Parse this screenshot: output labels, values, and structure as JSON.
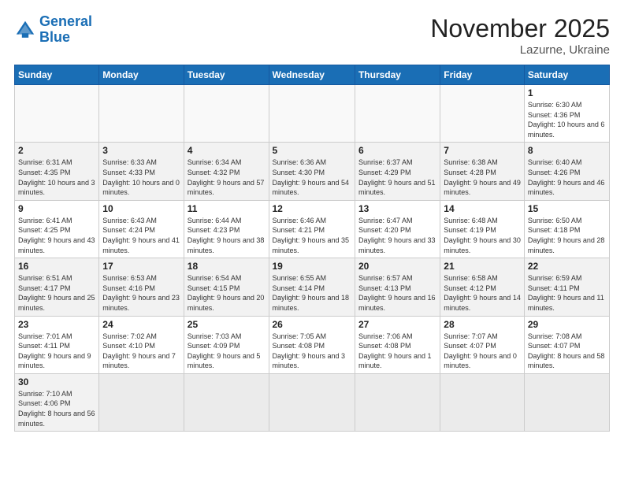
{
  "header": {
    "logo_general": "General",
    "logo_blue": "Blue",
    "title": "November 2025",
    "subtitle": "Lazurne, Ukraine"
  },
  "weekdays": [
    "Sunday",
    "Monday",
    "Tuesday",
    "Wednesday",
    "Thursday",
    "Friday",
    "Saturday"
  ],
  "weeks": [
    {
      "days": [
        {
          "num": "",
          "info": ""
        },
        {
          "num": "",
          "info": ""
        },
        {
          "num": "",
          "info": ""
        },
        {
          "num": "",
          "info": ""
        },
        {
          "num": "",
          "info": ""
        },
        {
          "num": "",
          "info": ""
        },
        {
          "num": "1",
          "info": "Sunrise: 6:30 AM\nSunset: 4:36 PM\nDaylight: 10 hours and 6 minutes."
        }
      ]
    },
    {
      "days": [
        {
          "num": "2",
          "info": "Sunrise: 6:31 AM\nSunset: 4:35 PM\nDaylight: 10 hours and 3 minutes."
        },
        {
          "num": "3",
          "info": "Sunrise: 6:33 AM\nSunset: 4:33 PM\nDaylight: 10 hours and 0 minutes."
        },
        {
          "num": "4",
          "info": "Sunrise: 6:34 AM\nSunset: 4:32 PM\nDaylight: 9 hours and 57 minutes."
        },
        {
          "num": "5",
          "info": "Sunrise: 6:36 AM\nSunset: 4:30 PM\nDaylight: 9 hours and 54 minutes."
        },
        {
          "num": "6",
          "info": "Sunrise: 6:37 AM\nSunset: 4:29 PM\nDaylight: 9 hours and 51 minutes."
        },
        {
          "num": "7",
          "info": "Sunrise: 6:38 AM\nSunset: 4:28 PM\nDaylight: 9 hours and 49 minutes."
        },
        {
          "num": "8",
          "info": "Sunrise: 6:40 AM\nSunset: 4:26 PM\nDaylight: 9 hours and 46 minutes."
        }
      ]
    },
    {
      "days": [
        {
          "num": "9",
          "info": "Sunrise: 6:41 AM\nSunset: 4:25 PM\nDaylight: 9 hours and 43 minutes."
        },
        {
          "num": "10",
          "info": "Sunrise: 6:43 AM\nSunset: 4:24 PM\nDaylight: 9 hours and 41 minutes."
        },
        {
          "num": "11",
          "info": "Sunrise: 6:44 AM\nSunset: 4:23 PM\nDaylight: 9 hours and 38 minutes."
        },
        {
          "num": "12",
          "info": "Sunrise: 6:46 AM\nSunset: 4:21 PM\nDaylight: 9 hours and 35 minutes."
        },
        {
          "num": "13",
          "info": "Sunrise: 6:47 AM\nSunset: 4:20 PM\nDaylight: 9 hours and 33 minutes."
        },
        {
          "num": "14",
          "info": "Sunrise: 6:48 AM\nSunset: 4:19 PM\nDaylight: 9 hours and 30 minutes."
        },
        {
          "num": "15",
          "info": "Sunrise: 6:50 AM\nSunset: 4:18 PM\nDaylight: 9 hours and 28 minutes."
        }
      ]
    },
    {
      "days": [
        {
          "num": "16",
          "info": "Sunrise: 6:51 AM\nSunset: 4:17 PM\nDaylight: 9 hours and 25 minutes."
        },
        {
          "num": "17",
          "info": "Sunrise: 6:53 AM\nSunset: 4:16 PM\nDaylight: 9 hours and 23 minutes."
        },
        {
          "num": "18",
          "info": "Sunrise: 6:54 AM\nSunset: 4:15 PM\nDaylight: 9 hours and 20 minutes."
        },
        {
          "num": "19",
          "info": "Sunrise: 6:55 AM\nSunset: 4:14 PM\nDaylight: 9 hours and 18 minutes."
        },
        {
          "num": "20",
          "info": "Sunrise: 6:57 AM\nSunset: 4:13 PM\nDaylight: 9 hours and 16 minutes."
        },
        {
          "num": "21",
          "info": "Sunrise: 6:58 AM\nSunset: 4:12 PM\nDaylight: 9 hours and 14 minutes."
        },
        {
          "num": "22",
          "info": "Sunrise: 6:59 AM\nSunset: 4:11 PM\nDaylight: 9 hours and 11 minutes."
        }
      ]
    },
    {
      "days": [
        {
          "num": "23",
          "info": "Sunrise: 7:01 AM\nSunset: 4:11 PM\nDaylight: 9 hours and 9 minutes."
        },
        {
          "num": "24",
          "info": "Sunrise: 7:02 AM\nSunset: 4:10 PM\nDaylight: 9 hours and 7 minutes."
        },
        {
          "num": "25",
          "info": "Sunrise: 7:03 AM\nSunset: 4:09 PM\nDaylight: 9 hours and 5 minutes."
        },
        {
          "num": "26",
          "info": "Sunrise: 7:05 AM\nSunset: 4:08 PM\nDaylight: 9 hours and 3 minutes."
        },
        {
          "num": "27",
          "info": "Sunrise: 7:06 AM\nSunset: 4:08 PM\nDaylight: 9 hours and 1 minute."
        },
        {
          "num": "28",
          "info": "Sunrise: 7:07 AM\nSunset: 4:07 PM\nDaylight: 9 hours and 0 minutes."
        },
        {
          "num": "29",
          "info": "Sunrise: 7:08 AM\nSunset: 4:07 PM\nDaylight: 8 hours and 58 minutes."
        }
      ]
    },
    {
      "days": [
        {
          "num": "30",
          "info": "Sunrise: 7:10 AM\nSunset: 4:06 PM\nDaylight: 8 hours and 56 minutes."
        },
        {
          "num": "",
          "info": ""
        },
        {
          "num": "",
          "info": ""
        },
        {
          "num": "",
          "info": ""
        },
        {
          "num": "",
          "info": ""
        },
        {
          "num": "",
          "info": ""
        },
        {
          "num": "",
          "info": ""
        }
      ]
    }
  ]
}
